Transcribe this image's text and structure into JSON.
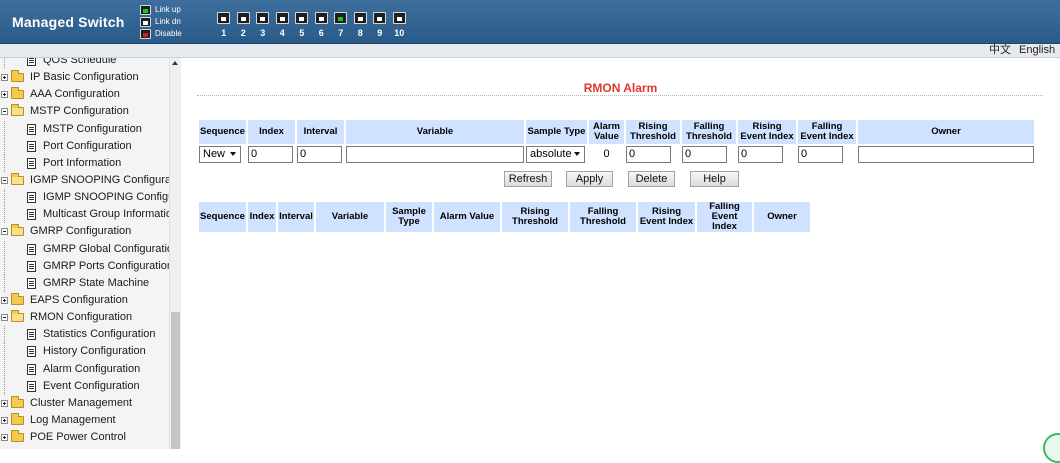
{
  "header": {
    "title": "Managed Switch",
    "legend": {
      "link_up": "Link up",
      "link_dn": "Link dn",
      "disable": "Disable"
    },
    "ports": [
      "1",
      "2",
      "3",
      "4",
      "5",
      "6",
      "7",
      "8",
      "9",
      "10"
    ],
    "port_states": [
      "down",
      "down",
      "down",
      "down",
      "down",
      "down",
      "up",
      "down",
      "down",
      "down"
    ]
  },
  "language": {
    "chinese": "中文",
    "english": "English"
  },
  "sidebar": {
    "items": [
      {
        "label": "QOS Schedule",
        "level": 1
      },
      {
        "label": "IP Basic Configuration",
        "level": 0
      },
      {
        "label": "AAA Configuration",
        "level": 0
      },
      {
        "label": "MSTP Configuration",
        "level": 0,
        "expanded": true
      },
      {
        "label": "MSTP Configuration",
        "level": 1
      },
      {
        "label": "Port Configuration",
        "level": 1
      },
      {
        "label": "Port Information",
        "level": 1
      },
      {
        "label": "IGMP SNOOPING Configuration",
        "level": 0,
        "expanded": true
      },
      {
        "label": "IGMP SNOOPING Configuration",
        "level": 1
      },
      {
        "label": "Multicast Group Information",
        "level": 1
      },
      {
        "label": "GMRP Configuration",
        "level": 0,
        "expanded": true
      },
      {
        "label": "GMRP Global Configuration",
        "level": 1
      },
      {
        "label": "GMRP Ports Configuration",
        "level": 1
      },
      {
        "label": "GMRP State Machine",
        "level": 1
      },
      {
        "label": "EAPS Configuration",
        "level": 0
      },
      {
        "label": "RMON Configuration",
        "level": 0,
        "expanded": true
      },
      {
        "label": "Statistics Configuration",
        "level": 1
      },
      {
        "label": "History Configuration",
        "level": 1
      },
      {
        "label": "Alarm Configuration",
        "level": 1
      },
      {
        "label": "Event Configuration",
        "level": 1
      },
      {
        "label": "Cluster Management",
        "level": 0
      },
      {
        "label": "Log Management",
        "level": 0
      },
      {
        "label": "POE Power Control",
        "level": 0
      }
    ]
  },
  "main": {
    "title": "RMON Alarm",
    "config_headers": {
      "sequence": "Sequence",
      "index": "Index",
      "interval": "Interval",
      "variable": "Variable",
      "sample_type": "Sample Type",
      "alarm_value": "Alarm Value",
      "rising_threshold": "Rising Threshold",
      "falling_threshold": "Falling Threshold",
      "rising_event_index": "Rising Event Index",
      "falling_event_index": "Falling Event Index",
      "owner": "Owner"
    },
    "config_row": {
      "sequence": "New",
      "index": "0",
      "interval": "0",
      "variable": "",
      "sample_type": "absolute",
      "alarm_value": "0",
      "rising_threshold": "0",
      "falling_threshold": "0",
      "rising_event_index": "0",
      "falling_event_index": "0",
      "owner": ""
    },
    "buttons": {
      "refresh": "Refresh",
      "apply": "Apply",
      "delete": "Delete",
      "help": "Help"
    },
    "result_headers": {
      "sequence": "Sequence",
      "index": "Index",
      "interval": "Interval",
      "variable": "Variable",
      "sample_type": "Sample Type",
      "alarm_value": "Alarm Value",
      "rising_threshold": "Rising Threshold",
      "falling_threshold": "Falling Threshold",
      "rising_event_index": "Rising Event Index",
      "falling_event_index": "Falling Event Index",
      "owner": "Owner"
    }
  }
}
